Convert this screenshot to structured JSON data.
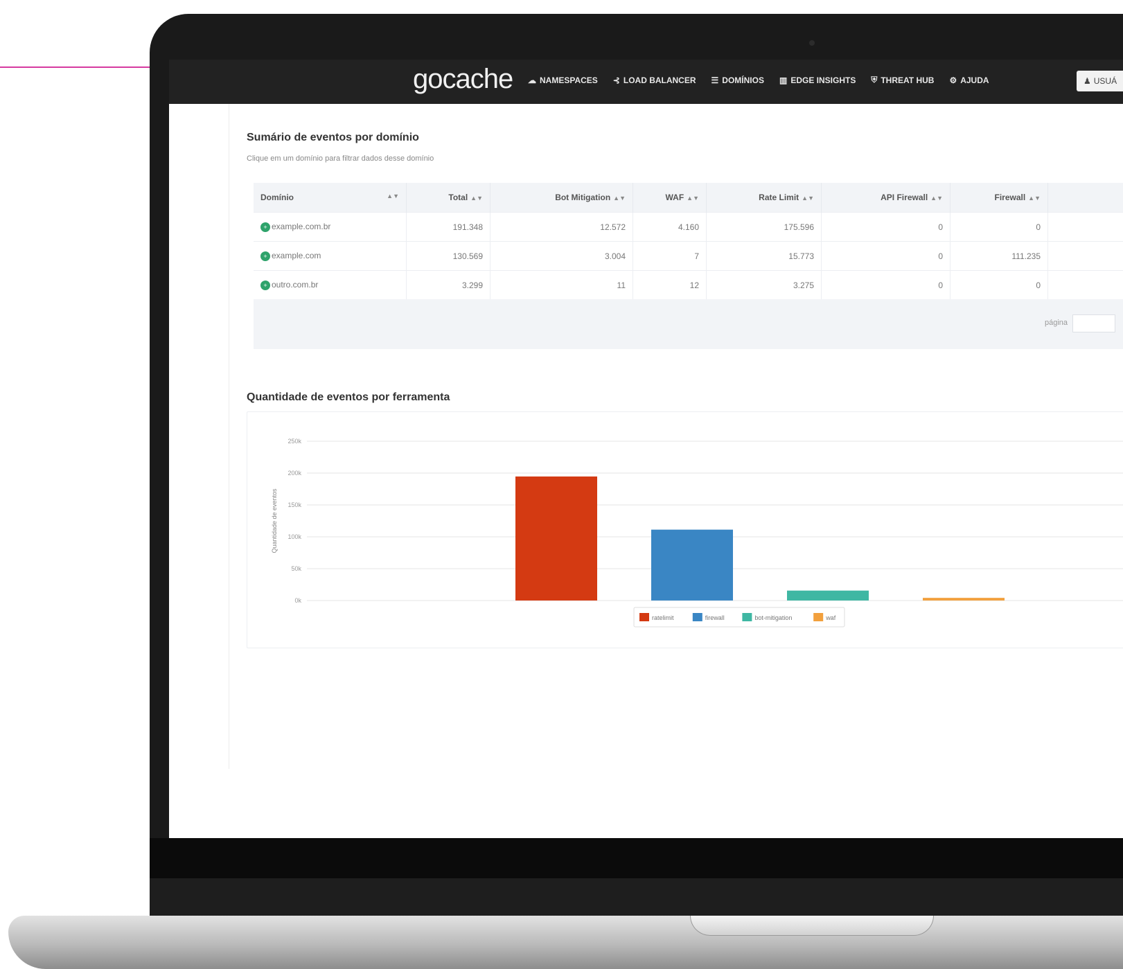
{
  "nav": {
    "logo": "gocache",
    "items": [
      {
        "icon": "☁",
        "label": "NAMESPACES"
      },
      {
        "icon": "⊰",
        "label": "LOAD BALANCER"
      },
      {
        "icon": "☰",
        "label": "DOMÍNIOS"
      },
      {
        "icon": "▥",
        "label": "EDGE INSIGHTS"
      },
      {
        "icon": "⛨",
        "label": "THREAT HUB"
      },
      {
        "icon": "⚙",
        "label": "AJUDA"
      }
    ],
    "user_label": "USUÁ",
    "user_icon": "user-icon"
  },
  "summary": {
    "title": "Sumário de eventos por domínio",
    "subtitle": "Clique em um domínio para filtrar dados desse domínio",
    "columns": [
      "Domínio",
      "Total",
      "Bot Mitigation",
      "WAF",
      "Rate Limit",
      "API Firewall",
      "Firewall"
    ],
    "rows": [
      [
        "example.com.br",
        "191.348",
        "12.572",
        "4.160",
        "175.596",
        "0",
        "0"
      ],
      [
        "example.com",
        "130.569",
        "3.004",
        "7",
        "15.773",
        "0",
        "111.235"
      ],
      [
        "outro.com.br",
        "3.299",
        "11",
        "12",
        "3.275",
        "0",
        "0"
      ]
    ],
    "pager_label": "página"
  },
  "tools_chart": {
    "title": "Quantidade de eventos por ferramenta",
    "colors": {
      "ratelimit": "#d43a12",
      "firewall": "#3a86c4",
      "bot-mitigation": "#3fb7a3",
      "waf": "#f2a03d"
    }
  },
  "chart_data": {
    "type": "bar",
    "title": "",
    "ylabel": "Quantidade de eventos",
    "xlabel": "",
    "ylim": [
      0,
      250000
    ],
    "yticks": [
      0,
      50000,
      100000,
      150000,
      200000,
      250000
    ],
    "ytick_labels": [
      "0k",
      "50k",
      "100k",
      "150k",
      "200k",
      "250k"
    ],
    "grid": true,
    "legend": "bottom-center",
    "series": [
      {
        "name": "ratelimit",
        "value": 194644,
        "color": "#d43a12"
      },
      {
        "name": "firewall",
        "value": 111235,
        "color": "#3a86c4"
      },
      {
        "name": "bot-mitigation",
        "value": 15587,
        "color": "#3fb7a3"
      },
      {
        "name": "waf",
        "value": 4179,
        "color": "#f2a03d"
      }
    ]
  }
}
